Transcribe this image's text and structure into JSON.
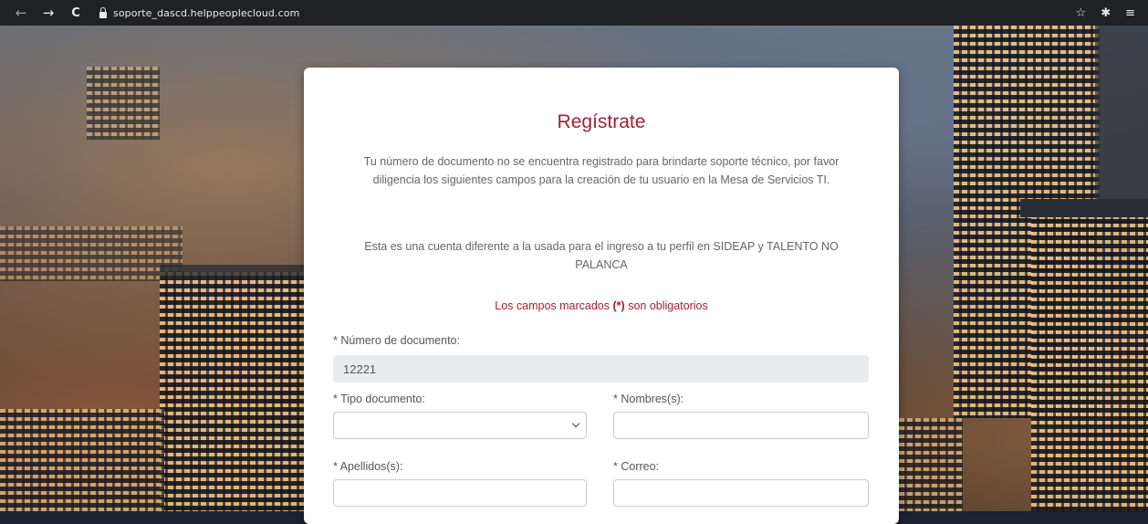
{
  "browser": {
    "url": "soporte_dascd.helppeoplecloud.com",
    "back_icon": "←",
    "forward_icon": "→",
    "reload_icon": "C",
    "star_icon": "☆",
    "extensions_icon": "✱",
    "menu_icon": "≡"
  },
  "form": {
    "title": "Regístrate",
    "intro": "Tu número de documento no se encuentra registrado para brindarte soporte técnico, por favor diligencia los siguientes campos para la creación de tu usuario en la Mesa de Servicios TI.",
    "note": "Esta es una cuenta diferente a la usada para el ingreso a tu perfil en SIDEAP y TALENTO NO PALANCA",
    "required_prefix": "Los campos marcados",
    "required_mark": "(*)",
    "required_suffix": "son obligatorios",
    "fields": {
      "documento": {
        "label": "* Número de documento:",
        "value": "12221"
      },
      "tipo": {
        "label": "* Tipo documento:",
        "value": ""
      },
      "nombres": {
        "label": "* Nombres(s):",
        "value": ""
      },
      "apellidos": {
        "label": "* Apellidos(s):",
        "value": ""
      },
      "correo": {
        "label": "* Correo:",
        "value": ""
      }
    }
  },
  "colors": {
    "accent": "#a31f34",
    "chrome": "#202124"
  }
}
